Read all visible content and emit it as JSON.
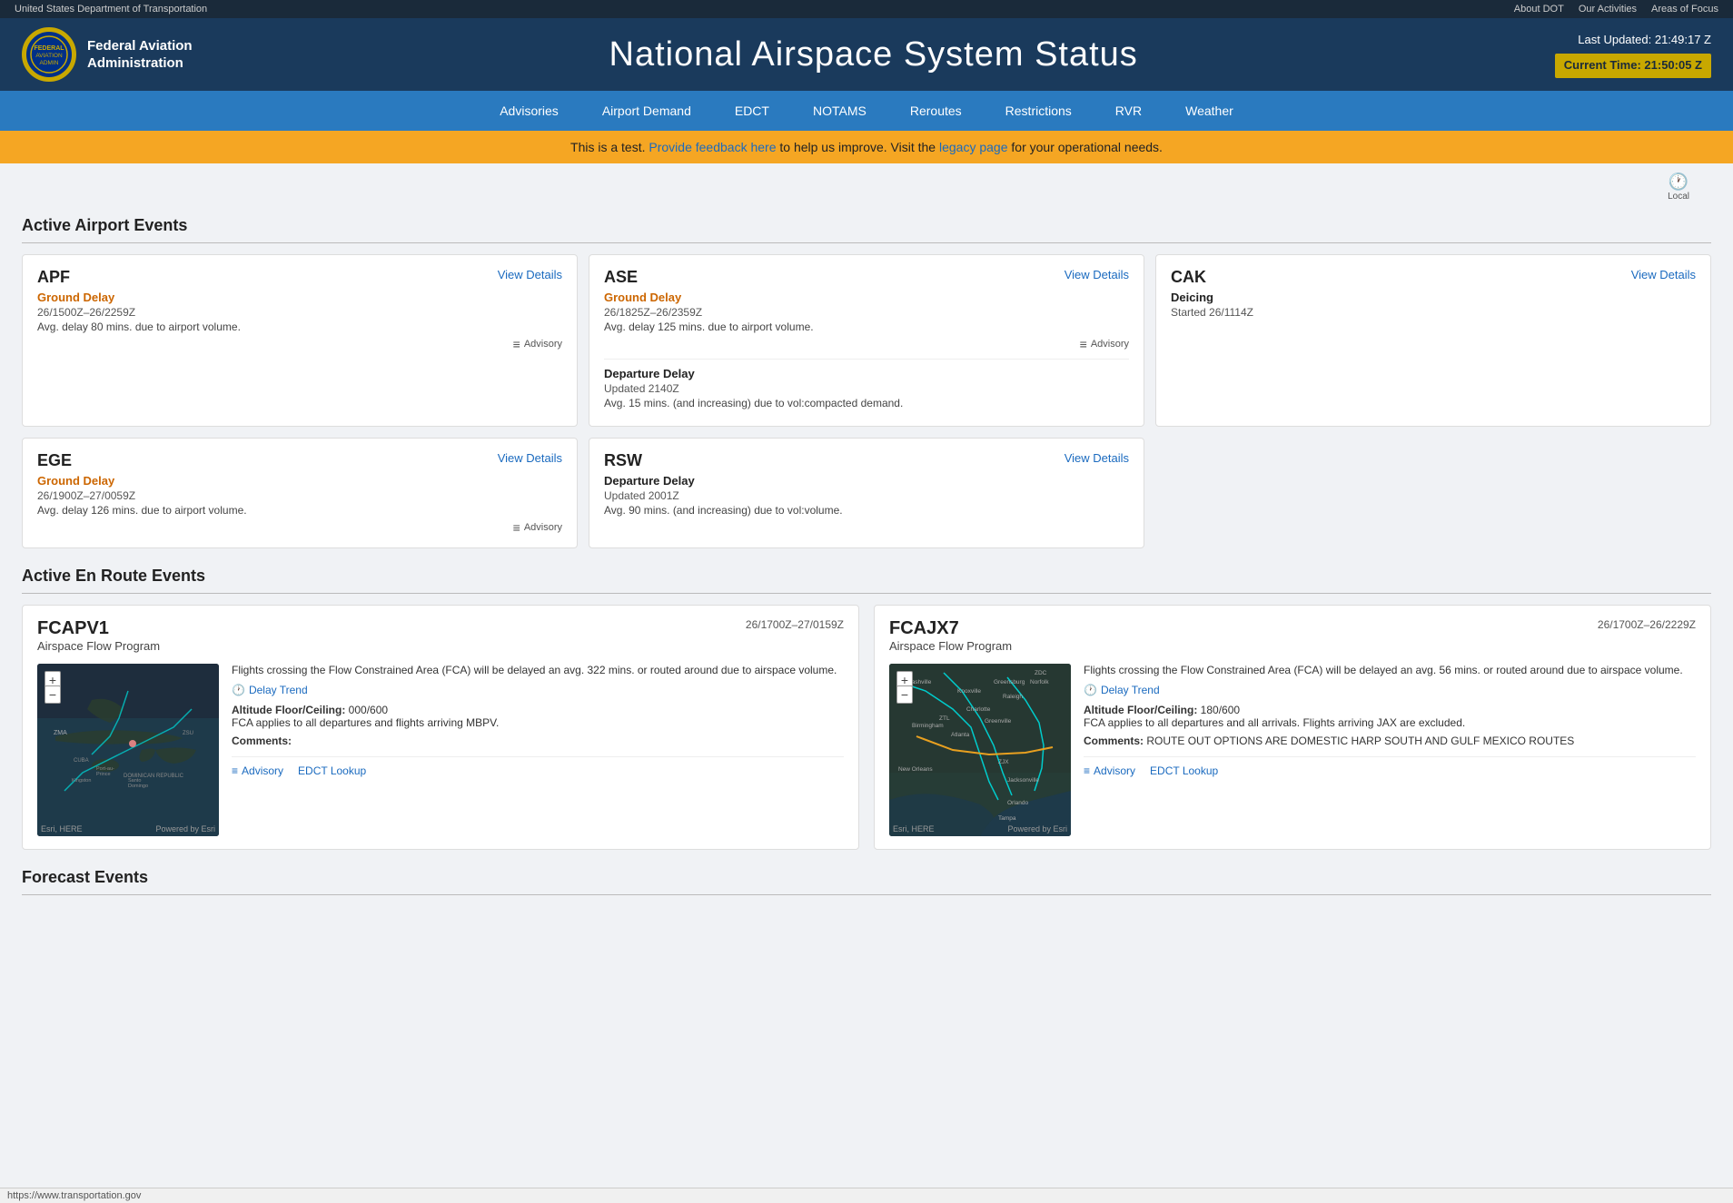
{
  "topbar": {
    "department": "United States Department of Transportation",
    "links": [
      "About DOT",
      "Our Activities",
      "Areas of Focus"
    ]
  },
  "header": {
    "brand": "Federal Aviation\nAdministration",
    "title": "National Airspace System Status",
    "last_updated_label": "Last Updated:",
    "last_updated_time": "21:49:17 Z",
    "current_time_label": "Current Time:",
    "current_time": "21:50:05 Z"
  },
  "nav": {
    "items": [
      "Advisories",
      "Airport Demand",
      "EDCT",
      "NOTAMS",
      "Reroutes",
      "Restrictions",
      "RVR",
      "Weather"
    ]
  },
  "banner": {
    "text_before": "This is a test.",
    "feedback_link": "Provide feedback here",
    "text_middle": "to help us improve. Visit the",
    "legacy_link": "legacy page",
    "text_after": "for your operational needs."
  },
  "local": "Local",
  "airport_section": {
    "title": "Active Airport Events"
  },
  "airport_cards": [
    {
      "code": "APF",
      "view_details": "View Details",
      "events": [
        {
          "type": "Ground Delay",
          "type_color": "orange",
          "time": "26/1500Z–26/2259Z",
          "desc": "Avg. delay 80 mins. due to airport volume.",
          "advisory": true
        }
      ]
    },
    {
      "code": "ASE",
      "view_details": "View Details",
      "events": [
        {
          "type": "Ground Delay",
          "type_color": "orange",
          "time": "26/1825Z–26/2359Z",
          "desc": "Avg. delay 125 mins. due to airport volume.",
          "advisory": true
        },
        {
          "type": "Departure Delay",
          "type_color": "normal",
          "time": "Updated 2140Z",
          "desc": "Avg. 15 mins. (and increasing) due to vol:compacted demand.",
          "advisory": false
        }
      ]
    },
    {
      "code": "CAK",
      "view_details": "View Details",
      "events": [
        {
          "type": "Deicing",
          "type_color": "normal",
          "time": "Started 26/1114Z",
          "desc": "",
          "advisory": false
        }
      ]
    },
    {
      "code": "EGE",
      "view_details": "View Details",
      "events": [
        {
          "type": "Ground Delay",
          "type_color": "orange",
          "time": "26/1900Z–27/0059Z",
          "desc": "Avg. delay 126 mins. due to airport volume.",
          "advisory": true
        }
      ]
    },
    {
      "code": "RSW",
      "view_details": "View Details",
      "events": [
        {
          "type": "Departure Delay",
          "type_color": "normal",
          "time": "Updated 2001Z",
          "desc": "Avg. 90 mins. (and increasing) due to vol:volume.",
          "advisory": false
        }
      ]
    },
    {
      "code": "",
      "view_details": "",
      "events": []
    }
  ],
  "enroute_section": {
    "title": "Active En Route Events"
  },
  "enroute_cards": [
    {
      "code": "FCAPV1",
      "subtitle": "Airspace Flow Program",
      "time": "26/1700Z–27/0159Z",
      "desc": "Flights crossing the Flow Constrained Area (FCA) will be delayed an avg. 322 mins. or routed around due to airspace volume.",
      "delay_trend": "Delay Trend",
      "altitude_label": "Altitude Floor/Ceiling:",
      "altitude_value": "000/600",
      "altitude_desc": "FCA applies to all departures and flights arriving MBPV.",
      "comments_label": "Comments:",
      "comments_value": "",
      "advisory_label": "Advisory",
      "edct_label": "EDCT Lookup",
      "map_labels": [
        "ZMA",
        "CUBA",
        "DOMINICAN REPUBLIC",
        "Port-au-Prince",
        "Santo Domingo",
        "Kingston",
        "ZSU",
        "Esri, HERE",
        "Powered by Esri"
      ]
    },
    {
      "code": "FCAJX7",
      "subtitle": "Airspace Flow Program",
      "time": "26/1700Z–26/2229Z",
      "desc": "Flights crossing the Flow Constrained Area (FCA) will be delayed an avg. 56 mins. or routed around due to airspace volume.",
      "delay_trend": "Delay Trend",
      "altitude_label": "Altitude Floor/Ceiling:",
      "altitude_value": "180/600",
      "altitude_desc": "FCA applies to all departures and all arrivals. Flights arriving JAX are excluded.",
      "comments_label": "Comments:",
      "comments_value": "ROUTE OUT OPTIONS ARE DOMESTIC HARP SOUTH AND GULF MEXICO ROUTES",
      "advisory_label": "Advisory",
      "edct_label": "EDCT Lookup",
      "map_labels": [
        "Nashville",
        "ZDC",
        "Norfolk",
        "Knoxville",
        "Greensburg",
        "Raleigh",
        "Charlotte",
        "Greenville",
        "ZTL",
        "Atlanta",
        "Birmingham",
        "ZJX",
        "Jacksonville",
        "New Orleans",
        "Orlando",
        "Tampa",
        "Esri, HERE",
        "Powered by Esri"
      ]
    }
  ],
  "forecast_section": {
    "title": "Forecast Events"
  },
  "legend": {
    "advisory1_label": "= Advisory",
    "advisory2_label": "= Advisory"
  }
}
